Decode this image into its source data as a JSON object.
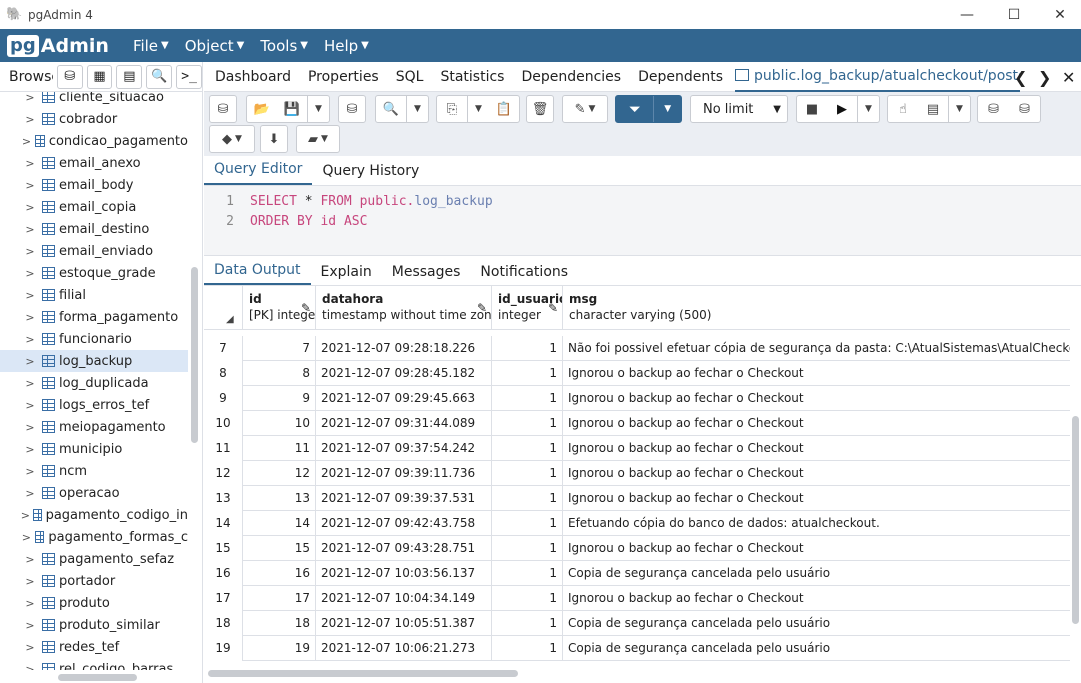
{
  "window": {
    "title": "pgAdmin 4",
    "minimize": "—",
    "maximize": "☐",
    "close": "✕"
  },
  "menu": {
    "logo_pg": "pg",
    "logo_admin": "Admin",
    "items": [
      "File",
      "Object",
      "Tools",
      "Help"
    ]
  },
  "sidebar": {
    "label": "Browser",
    "items": [
      "cliente_situacao",
      "cobrador",
      "condicao_pagamento",
      "email_anexo",
      "email_body",
      "email_copia",
      "email_destino",
      "email_enviado",
      "estoque_grade",
      "filial",
      "forma_pagamento",
      "funcionario",
      "log_backup",
      "log_duplicada",
      "logs_erros_tef",
      "meiopagamento",
      "municipio",
      "ncm",
      "operacao",
      "pagamento_codigo_in",
      "pagamento_formas_c",
      "pagamento_sefaz",
      "portador",
      "produto",
      "produto_similar",
      "redes_tef",
      "rel_codigo_barras"
    ],
    "selected": "log_backup"
  },
  "tabs": [
    "Dashboard",
    "Properties",
    "SQL",
    "Statistics",
    "Dependencies",
    "Dependents"
  ],
  "active_tab": "public.log_backup/atualcheckout/postgres@",
  "toolbar": {
    "limit": "No limit"
  },
  "editor_tabs": [
    "Query Editor",
    "Query History"
  ],
  "query": {
    "line1": {
      "n": "1",
      "kw1": "SELECT",
      "star": " * ",
      "kw2": "FROM",
      "schema": " public.",
      "table": "log_backup"
    },
    "line2": {
      "n": "2",
      "kw1": "ORDER BY",
      "col": " id ",
      "kw2": "ASC"
    }
  },
  "output_tabs": [
    "Data Output",
    "Explain",
    "Messages",
    "Notifications"
  ],
  "grid": {
    "columns": [
      {
        "name": "id",
        "type": "[PK] integer"
      },
      {
        "name": "datahora",
        "type": "timestamp without time zone"
      },
      {
        "name": "id_usuario",
        "type": "integer"
      },
      {
        "name": "msg",
        "type": "character varying (500)"
      }
    ],
    "rows": [
      {
        "rn": "7",
        "id": "7",
        "datahora": "2021-12-07 09:28:18.226",
        "id_usuario": "1",
        "msg": "Não foi possivel efetuar cópia de segurança da pasta: C:\\AtualSistemas\\AtualCheckout\\"
      },
      {
        "rn": "8",
        "id": "8",
        "datahora": "2021-12-07 09:28:45.182",
        "id_usuario": "1",
        "msg": "Ignorou o backup ao fechar o Checkout"
      },
      {
        "rn": "9",
        "id": "9",
        "datahora": "2021-12-07 09:29:45.663",
        "id_usuario": "1",
        "msg": "Ignorou o backup ao fechar o Checkout"
      },
      {
        "rn": "10",
        "id": "10",
        "datahora": "2021-12-07 09:31:44.089",
        "id_usuario": "1",
        "msg": "Ignorou o backup ao fechar o Checkout"
      },
      {
        "rn": "11",
        "id": "11",
        "datahora": "2021-12-07 09:37:54.242",
        "id_usuario": "1",
        "msg": "Ignorou o backup ao fechar o Checkout"
      },
      {
        "rn": "12",
        "id": "12",
        "datahora": "2021-12-07 09:39:11.736",
        "id_usuario": "1",
        "msg": "Ignorou o backup ao fechar o Checkout"
      },
      {
        "rn": "13",
        "id": "13",
        "datahora": "2021-12-07 09:39:37.531",
        "id_usuario": "1",
        "msg": "Ignorou o backup ao fechar o Checkout"
      },
      {
        "rn": "14",
        "id": "14",
        "datahora": "2021-12-07 09:42:43.758",
        "id_usuario": "1",
        "msg": "Efetuando cópia do banco de dados: atualcheckout."
      },
      {
        "rn": "15",
        "id": "15",
        "datahora": "2021-12-07 09:43:28.751",
        "id_usuario": "1",
        "msg": "Ignorou o backup ao fechar o Checkout"
      },
      {
        "rn": "16",
        "id": "16",
        "datahora": "2021-12-07 10:03:56.137",
        "id_usuario": "1",
        "msg": "Copia de segurança cancelada pelo usuário"
      },
      {
        "rn": "17",
        "id": "17",
        "datahora": "2021-12-07 10:04:34.149",
        "id_usuario": "1",
        "msg": "Ignorou o backup ao fechar o Checkout"
      },
      {
        "rn": "18",
        "id": "18",
        "datahora": "2021-12-07 10:05:51.387",
        "id_usuario": "1",
        "msg": "Copia de segurança cancelada pelo usuário"
      },
      {
        "rn": "19",
        "id": "19",
        "datahora": "2021-12-07 10:06:21.273",
        "id_usuario": "1",
        "msg": "Copia de segurança cancelada pelo usuário"
      }
    ]
  }
}
